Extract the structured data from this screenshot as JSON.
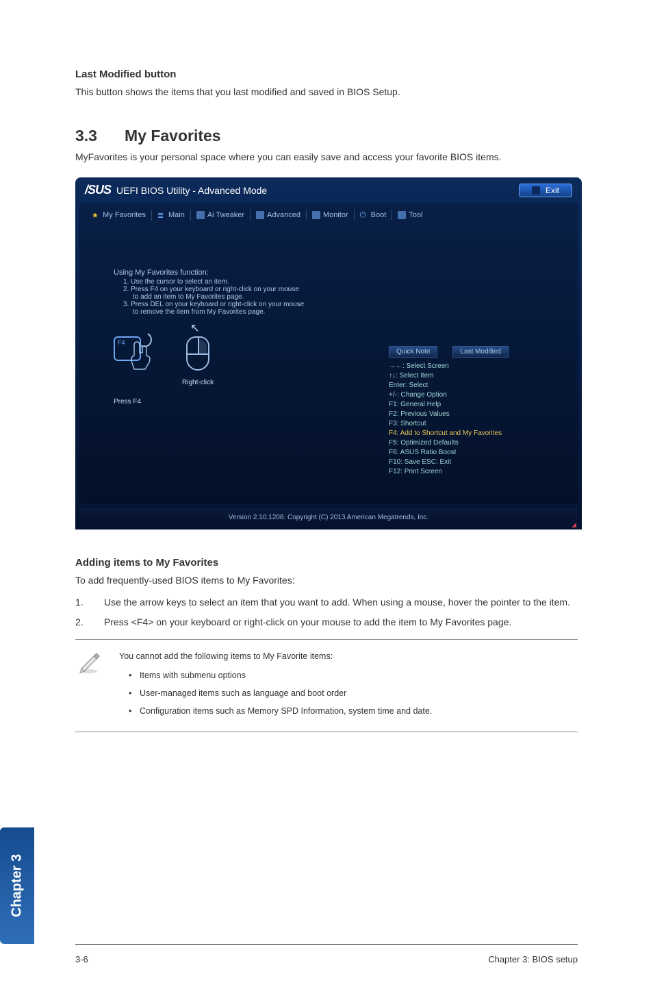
{
  "sideTab": "Chapter 3",
  "lastModified": {
    "heading": "Last Modified button",
    "text": "This button shows the items that you last modified and saved in BIOS Setup."
  },
  "mainHeading": {
    "num": "3.3",
    "title": "My Favorites"
  },
  "intro": "MyFavorites is your personal space where you can easily save and access your favorite BIOS items.",
  "bios": {
    "brandLogo": "/SUS",
    "brandText": "UEFI BIOS Utility - Advanced Mode",
    "exit": "Exit",
    "tabs": {
      "fav": "My Favorites",
      "main": "Main",
      "ai": "Ai Tweaker",
      "adv": "Advanced",
      "mon": "Monitor",
      "boot": "Boot",
      "tool": "Tool"
    },
    "fav": {
      "heading": "Using My Favorites function:",
      "l1": "1. Use the cursor to select an item.",
      "l2": "2. Press F4 on your keyboard or right-click on your mouse",
      "l2b": "to add an item to My Favorites page.",
      "l3": "3. Press DEL on your keyboard or right-click on your mouse",
      "l3b": "to remove the item from My Favorites page.",
      "keyLabel": "F4",
      "label1": "Press F4",
      "label2": "Right-click"
    },
    "qn": {
      "btn1": "Quick Note",
      "btn2": "Last Modified",
      "l1": "→←: Select Screen",
      "l2": "↑↓: Select Item",
      "l3": "Enter: Select",
      "l4": "+/-: Change Option",
      "l5": "F1: General Help",
      "l6": "F2: Previous Values",
      "l7": "F3: Shortcut",
      "l8": "F4: Add to Shortcut and My Favorites",
      "l9": "F5: Optimized Defaults",
      "l10": "F6: ASUS Ratio Boost",
      "l11": "F10: Save  ESC: Exit",
      "l12": "F12: Print Screen"
    },
    "footer": "Version 2.10.1208. Copyright (C) 2013 American Megatrends, Inc."
  },
  "adding": {
    "heading": "Adding items to My Favorites",
    "intro": "To add frequently-used BIOS items to My Favorites:",
    "s1num": "1.",
    "s1": "Use the arrow keys to select an item that you want to add. When using a mouse, hover the pointer to the item.",
    "s2num": "2.",
    "s2": "Press <F4> on your keyboard or right-click on your mouse to add the item to My Favorites page."
  },
  "note": {
    "intro": "You cannot add the following items to My Favorite items:",
    "b1": "Items with submenu options",
    "b2": "User-managed items such as language and boot order",
    "b3": "Configuration items such as Memory SPD Information, system time and date."
  },
  "footer": {
    "left": "3-6",
    "right": "Chapter 3: BIOS setup"
  }
}
